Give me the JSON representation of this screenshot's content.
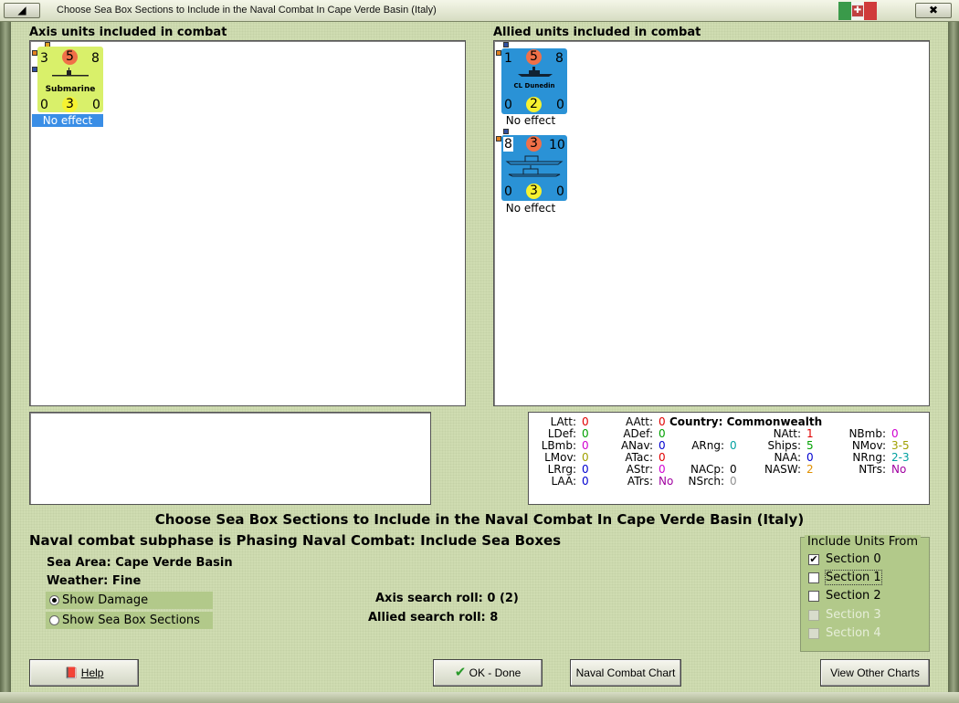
{
  "window": {
    "title": "Choose Sea Box Sections to Include in the Naval Combat In Cape Verde Basin (Italy)",
    "minimize_glyph": "◢",
    "close_glyph": "✖",
    "crest_glyph": "✚"
  },
  "axis_panel": {
    "label": "Axis units included in combat",
    "units": [
      {
        "attack": "3",
        "circle": "5",
        "right": "8",
        "name": "Submarine",
        "bl": "0",
        "bc": "3",
        "br": "0",
        "effect": "No effect"
      }
    ]
  },
  "allied_panel": {
    "label": "Allied units included in combat",
    "units": [
      {
        "attack": "1",
        "circle": "5",
        "right": "8",
        "name": "CL Dunedin",
        "bl": "0",
        "bc": "2",
        "br": "0",
        "effect": "No effect"
      },
      {
        "attack": "8",
        "circle": "3",
        "right": "10",
        "name": "",
        "bl": "0",
        "bc": "3",
        "br": "0",
        "effect": "No effect"
      }
    ]
  },
  "stats": {
    "country_label": "Country:",
    "country": "Commonwealth",
    "col1": [
      {
        "k": "LAtt:",
        "v": "0",
        "c": "#e00000"
      },
      {
        "k": "LDef:",
        "v": "0",
        "c": "#00a000"
      },
      {
        "k": "LBmb:",
        "v": "0",
        "c": "#d000d0"
      },
      {
        "k": "LMov:",
        "v": "0",
        "c": "#a0a000"
      },
      {
        "k": "LRrg:",
        "v": "0",
        "c": "#0000d0"
      },
      {
        "k": "LAA:",
        "v": "0",
        "c": "#0000d0"
      }
    ],
    "col2": [
      {
        "k": "AAtt:",
        "v": "0",
        "c": "#e00000"
      },
      {
        "k": "ADef:",
        "v": "0",
        "c": "#00a000"
      },
      {
        "k": "ANav:",
        "v": "0",
        "c": "#0000d0"
      },
      {
        "k": "ATac:",
        "v": "0",
        "c": "#e00000"
      },
      {
        "k": "AStr:",
        "v": "0",
        "c": "#d000d0"
      },
      {
        "k": "ATrs:",
        "v": "No",
        "c": "#a000a0"
      }
    ],
    "col3": [
      {
        "k": "ARng:",
        "v": "0",
        "c": "#00a0a0"
      },
      {
        "k": "NACp:",
        "v": "0",
        "c": "#000000"
      },
      {
        "k": "NSrch:",
        "v": "0",
        "c": "#909090"
      }
    ],
    "col4": [
      {
        "k": "NAtt:",
        "v": "1",
        "c": "#e00000"
      },
      {
        "k": "Ships:",
        "v": "5",
        "c": "#00a000"
      },
      {
        "k": "NAA:",
        "v": "0",
        "c": "#0000d0"
      },
      {
        "k": "NASW:",
        "v": "2",
        "c": "#e09000"
      }
    ],
    "col5": [
      {
        "k": "NBmb:",
        "v": "0",
        "c": "#d000d0"
      },
      {
        "k": "NMov:",
        "v": "3-5",
        "c": "#a0a000"
      },
      {
        "k": "NRng:",
        "v": "2-3",
        "c": "#00a0a0"
      },
      {
        "k": "NTrs:",
        "v": "No",
        "c": "#a000a0"
      }
    ]
  },
  "main": {
    "heading": "Choose Sea Box Sections to Include in the Naval Combat In Cape Verde Basin (Italy)",
    "subphase": "Naval combat subphase is Phasing Naval Combat: Include Sea Boxes",
    "sea_area_label": "Sea Area:",
    "sea_area": "Cape Verde Basin",
    "weather_label": "Weather:",
    "weather": "Fine",
    "axis_roll": "Axis search roll: 0 (2)",
    "allied_roll": "Allied search roll: 8"
  },
  "view_options": [
    {
      "label": "Show Damage",
      "selected": true
    },
    {
      "label": "Show Sea Box Sections",
      "selected": false
    }
  ],
  "include_units": {
    "title": "Include Units From",
    "sections": [
      {
        "label": "Section 0",
        "checked": true,
        "enabled": true
      },
      {
        "label": "Section 1",
        "checked": false,
        "enabled": true
      },
      {
        "label": "Section 2",
        "checked": false,
        "enabled": true
      },
      {
        "label": "Section 3",
        "checked": false,
        "enabled": false
      },
      {
        "label": "Section 4",
        "checked": false,
        "enabled": false
      }
    ]
  },
  "buttons": {
    "help": "Help",
    "ok": "OK - Done",
    "chart": "Naval Combat Chart",
    "other": "View Other Charts",
    "check_glyph": "✔",
    "book_glyph": "📕"
  },
  "colors": {
    "axis_counter": "#d9f06a",
    "allied_counter": "#2a92d6",
    "selected_effect": "#3a8ee6",
    "circle_red": "#f07048",
    "circle_yellow": "#f6f230"
  }
}
